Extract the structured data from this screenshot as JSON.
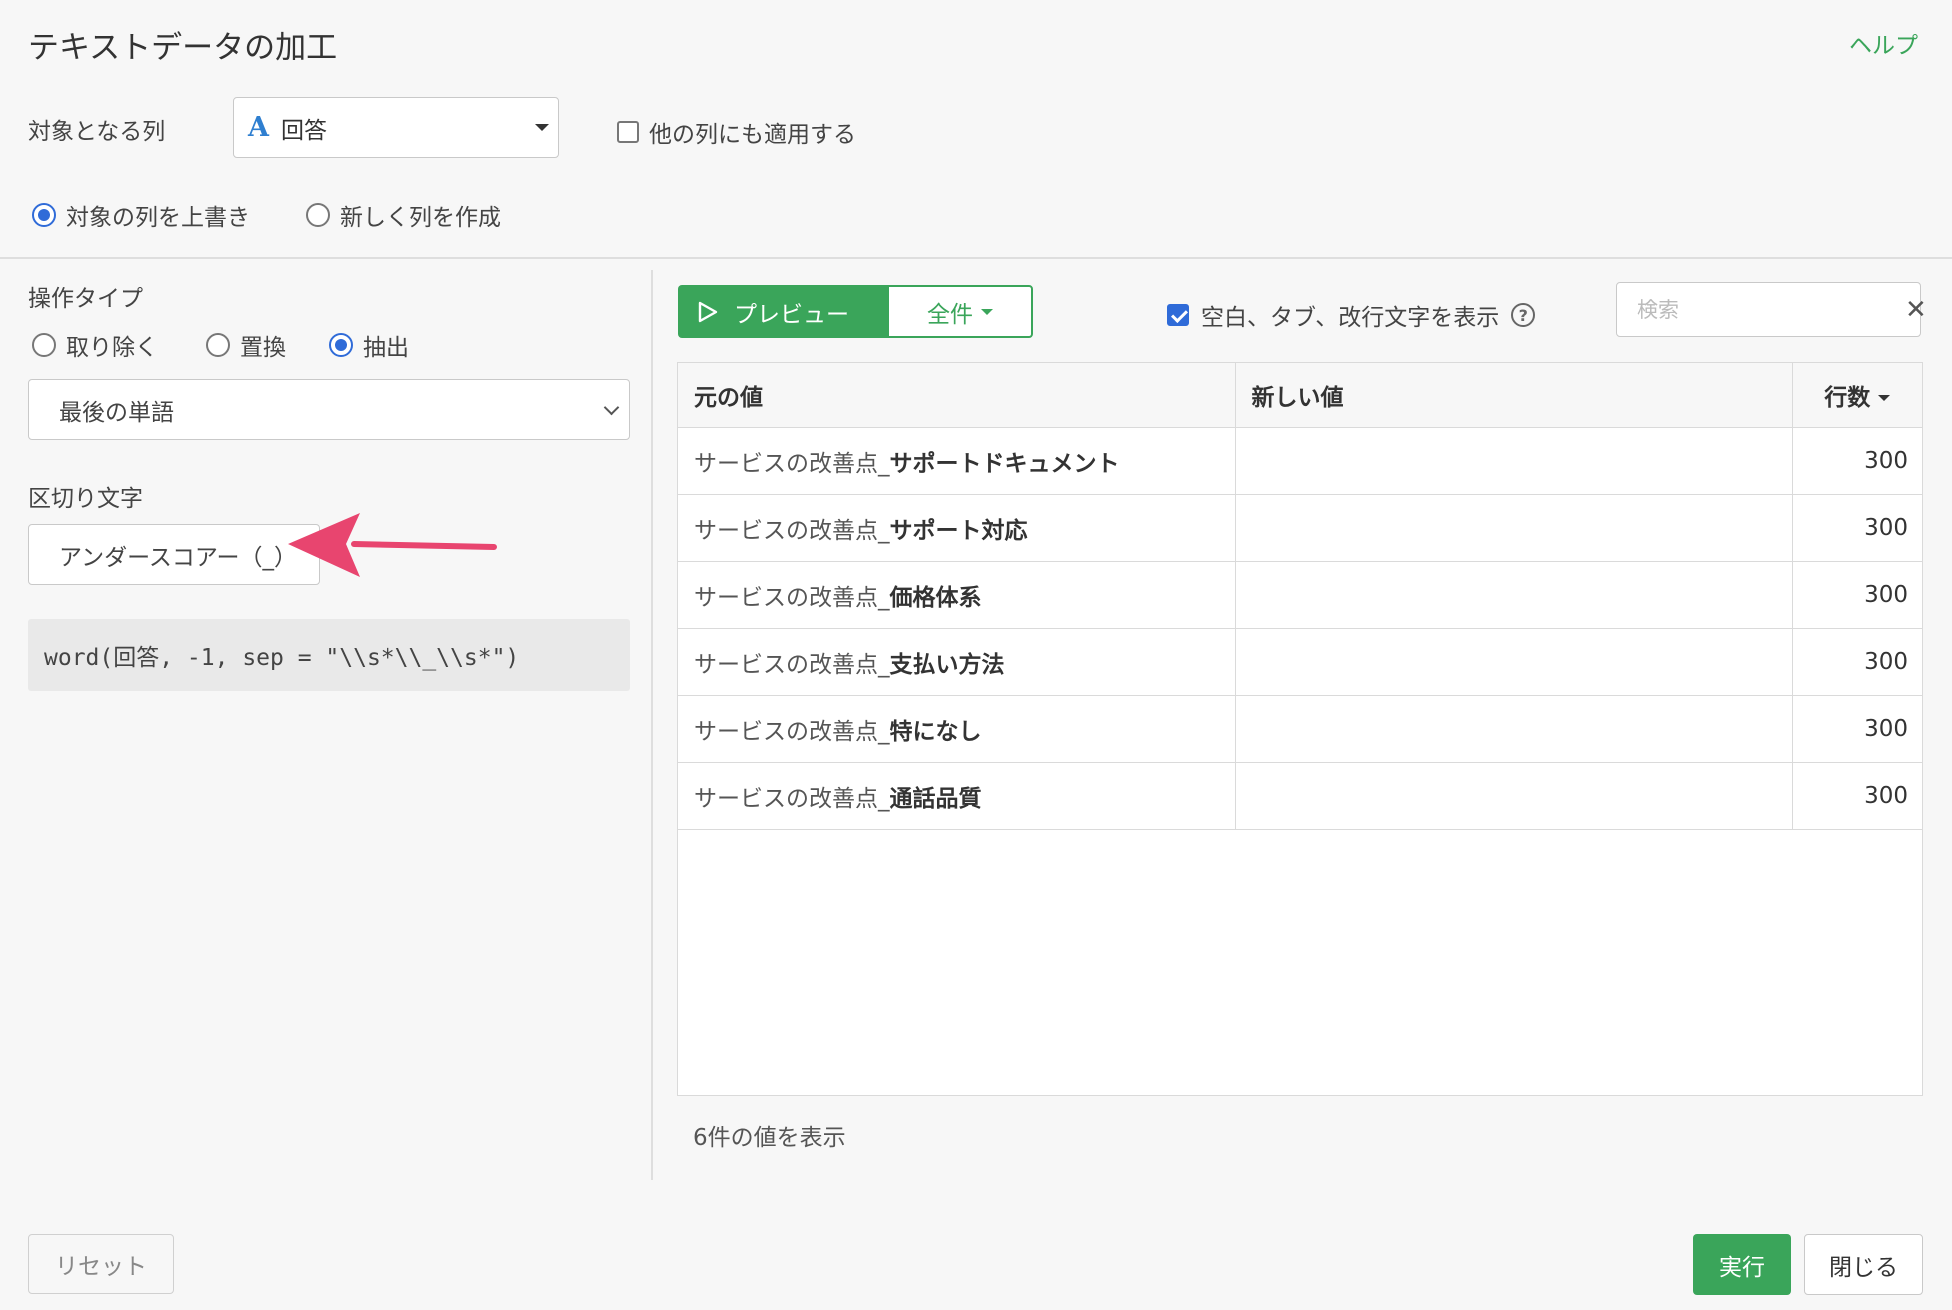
{
  "header": {
    "title": "テキストデータの加工",
    "help_label": "ヘルプ"
  },
  "target": {
    "label": "対象となる列",
    "column_type_icon": "A",
    "column_value": "回答",
    "apply_other_label": "他の列にも適用する",
    "apply_other_checked": false
  },
  "output_mode": {
    "overwrite_label": "対象の列を上書き",
    "new_column_label": "新しく列を作成",
    "selected": "overwrite"
  },
  "operation": {
    "type_label": "操作タイプ",
    "options": [
      "取り除く",
      "置換",
      "抽出"
    ],
    "selected": "抽出",
    "method_value": "最後の単語"
  },
  "separator": {
    "label": "区切り文字",
    "value": "アンダースコアー（_）"
  },
  "code": "word(回答, -1, sep = \"\\\\s*\\\\_\\\\s*\")",
  "toolbar": {
    "preview_label": "プレビュー",
    "count_label": "全件",
    "whitespace_label": "空白、タブ、改行文字を表示",
    "whitespace_checked": true,
    "search_placeholder": "検索"
  },
  "table": {
    "headers": [
      "元の値",
      "新しい値",
      "行数"
    ],
    "rows": [
      {
        "prefix": "サービスの改善点_",
        "word": "サポートドキュメント",
        "new_value": "",
        "count": "300"
      },
      {
        "prefix": "サービスの改善点_",
        "word": "サポート対応",
        "new_value": "",
        "count": "300"
      },
      {
        "prefix": "サービスの改善点_",
        "word": "価格体系",
        "new_value": "",
        "count": "300"
      },
      {
        "prefix": "サービスの改善点_",
        "word": "支払い方法",
        "new_value": "",
        "count": "300"
      },
      {
        "prefix": "サービスの改善点_",
        "word": "特になし",
        "new_value": "",
        "count": "300"
      },
      {
        "prefix": "サービスの改善点_",
        "word": "通話品質",
        "new_value": "",
        "count": "300"
      }
    ]
  },
  "status": "6件の値を表示",
  "footer": {
    "reset_label": "リセット",
    "run_label": "実行",
    "close_label": "閉じる"
  },
  "colors": {
    "accent": "#3aa55a",
    "radio_checkbox": "#2f6bd8",
    "annotation_arrow": "#e8456f"
  }
}
